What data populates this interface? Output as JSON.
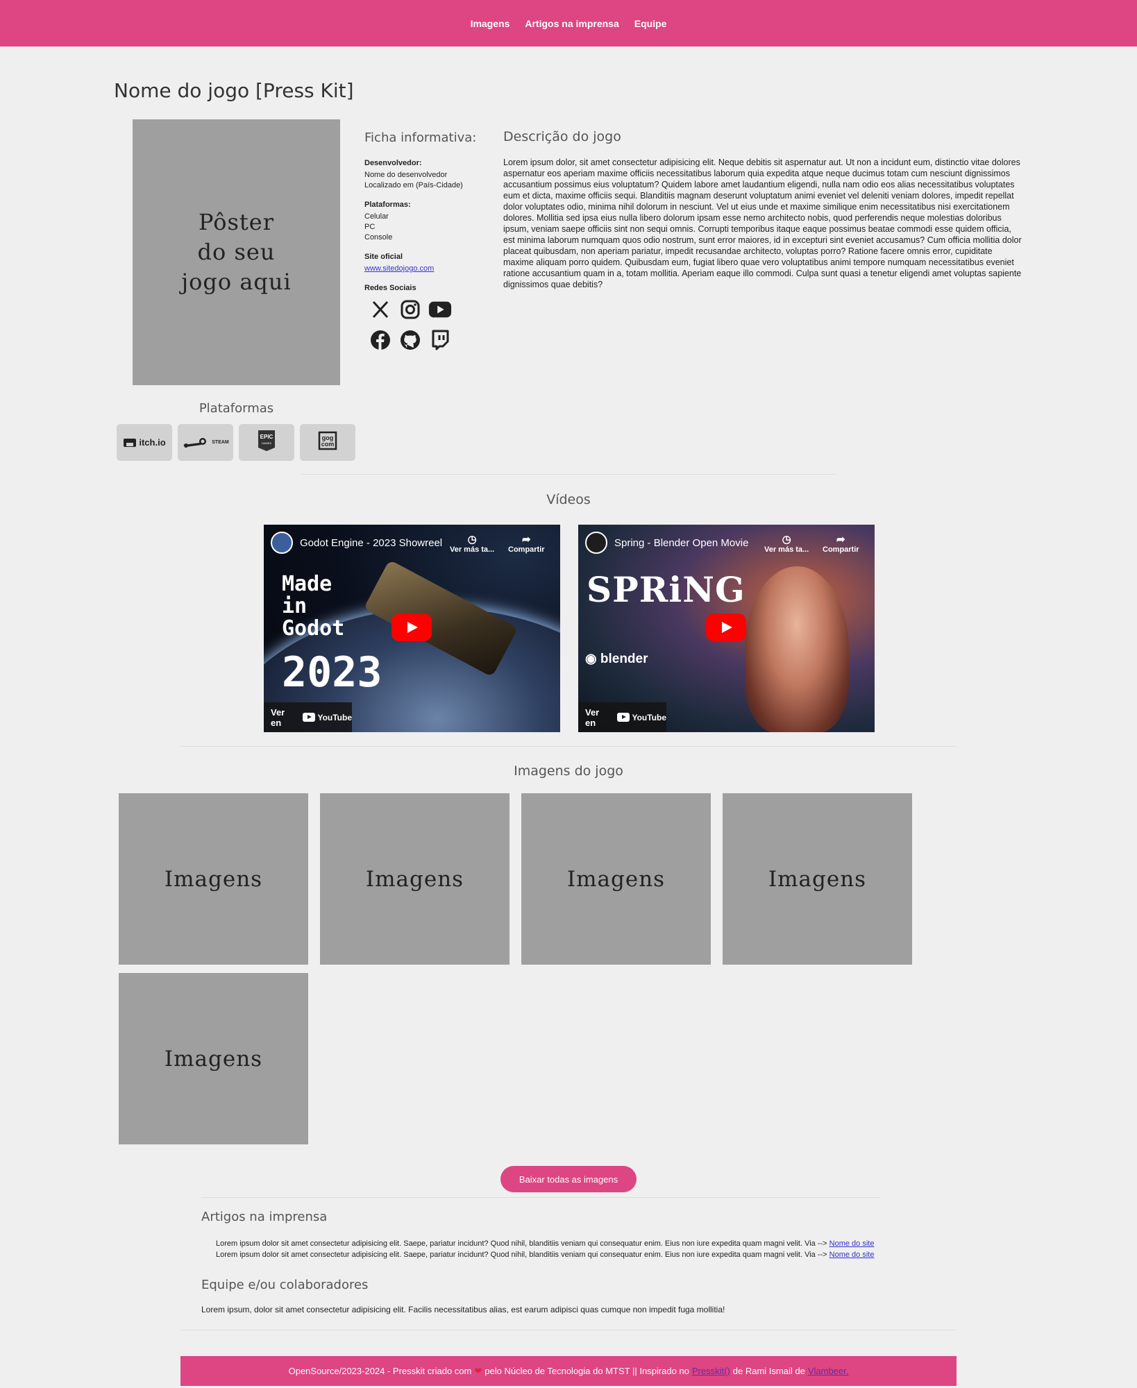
{
  "nav": {
    "items": [
      {
        "label": "Imagens"
      },
      {
        "label": "Artigos na imprensa"
      },
      {
        "label": "Equipe"
      }
    ]
  },
  "page_title": "Nome do jogo [Press Kit]",
  "poster": {
    "text": "Pôster\ndo seu\njogo aqui"
  },
  "platforms": {
    "title": "Plataformas",
    "stores": [
      {
        "name": "itch.io",
        "icon": "itchio-icon"
      },
      {
        "name": "STEAM",
        "icon": "steam-icon"
      },
      {
        "name": "EPIC GAMES",
        "icon": "epic-games-icon"
      },
      {
        "name": "gog com",
        "icon": "gog-icon"
      }
    ]
  },
  "facts": {
    "title": "Ficha informativa:",
    "developer_label": "Desenvolvedor:",
    "developer_name": "Nome do desenvolvedor",
    "developer_location": "Localizado em (País-Cidade)",
    "platforms_label": "Plataformas:",
    "platform_list": [
      "Celular",
      "PC",
      "Console"
    ],
    "site_label": "Site oficial",
    "site_link": "www.sitedojogo.com",
    "social_label": "Redes Sociais",
    "social_icons": [
      "x-icon",
      "instagram-icon",
      "youtube-icon",
      "facebook-icon",
      "github-icon",
      "twitch-icon"
    ]
  },
  "description": {
    "title": "Descrição do jogo",
    "text": "Lorem ipsum dolor, sit amet consectetur adipisicing elit. Neque debitis sit aspernatur aut. Ut non a incidunt eum, distinctio vitae dolores aspernatur eos aperiam maxime officiis necessitatibus laborum quia expedita atque neque ducimus totam cum nesciunt dignissimos accusantium possimus eius voluptatum? Quidem labore amet laudantium eligendi, nulla nam odio eos alias necessitatibus voluptates eum et dicta, maxime officiis sequi. Blanditiis magnam deserunt voluptatum animi eveniet vel deleniti veniam dolores, impedit repellat dolor voluptates odio, minima nihil dolorum in nesciunt. Vel ut eius unde et maxime similique enim necessitatibus nisi exercitationem dolores. Mollitia sed ipsa eius nulla libero dolorum ipsam esse nemo architecto nobis, quod perferendis neque molestias doloribus ipsum, veniam saepe officiis sint non sequi omnis. Corrupti temporibus itaque eaque possimus beatae commodi esse quidem officia, est minima laborum numquam quos odio nostrum, sunt error maiores, id in excepturi sint eveniet accusamus? Cum officia mollitia dolor placeat quibusdam, non aperiam pariatur, impedit recusandae architecto, voluptas porro? Ratione facere omnis error, cupiditate maxime aliquam porro quidem. Quibusdam eum, fugiat libero quae vero voluptatibus animi tempore numquam necessitatibus eveniet ratione accusantium quam in a, totam mollitia. Aperiam eaque illo commodi. Culpa sunt quasi a tenetur eligendi amet voluptas sapiente dignissimos quae debitis?"
  },
  "videos": {
    "title": "Vídeos",
    "items": [
      {
        "title": "Godot Engine - 2023 Showreel",
        "later": "Ver más ta...",
        "share": "Compartir",
        "watch_on": "Ver en",
        "yt": "YouTube",
        "big_lines": [
          "Made",
          "in",
          "Godot"
        ],
        "year": "2023"
      },
      {
        "title": "Spring - Blender Open Movie",
        "later": "Ver más ta...",
        "share": "Compartir",
        "watch_on": "Ver en",
        "yt": "YouTube",
        "logo_text": "SPRiNG",
        "brand": "blender"
      }
    ]
  },
  "images": {
    "title": "Imagens do jogo",
    "tiles": [
      "Imagens",
      "Imagens",
      "Imagens",
      "Imagens",
      "Imagens"
    ],
    "download_label": "Baixar todas as imagens"
  },
  "press": {
    "title": "Artigos na imprensa",
    "articles": [
      {
        "text": "Lorem ipsum dolor sit amet consectetur adipisicing elit. Saepe, pariatur incidunt? Quod nihil, blanditiis veniam qui consequatur enim. Eius non iure expedita quam magni velit. Via --> ",
        "link": "Nome do site"
      },
      {
        "text": "Lorem ipsum dolor sit amet consectetur adipisicing elit. Saepe, pariatur incidunt? Quod nihil, blanditiis veniam qui consequatur enim. Eius non iure expedita quam magni velit. Via --> ",
        "link": "Nome do site"
      }
    ]
  },
  "team": {
    "title": "Equipe e/ou colaboradores",
    "text": "Lorem ipsum, dolor sit amet consectetur adipisicing elit. Facilis necessitatibus alias, est earum adipisci quas cumque non impedit fuga mollitia!"
  },
  "footer": {
    "prefix": "OpenSource/2023-2024 - Presskit criado com",
    "middle": "pelo Núcleo de Tecnologia do MTST || Inspirado no",
    "presskit_link": "Presskit()",
    "by": "de Rami Ismail de",
    "vlambeer_link": "Vlambeer."
  },
  "colors": {
    "accent": "#dd4583",
    "placeholder": "#9f9f9f",
    "background": "#efefef"
  }
}
